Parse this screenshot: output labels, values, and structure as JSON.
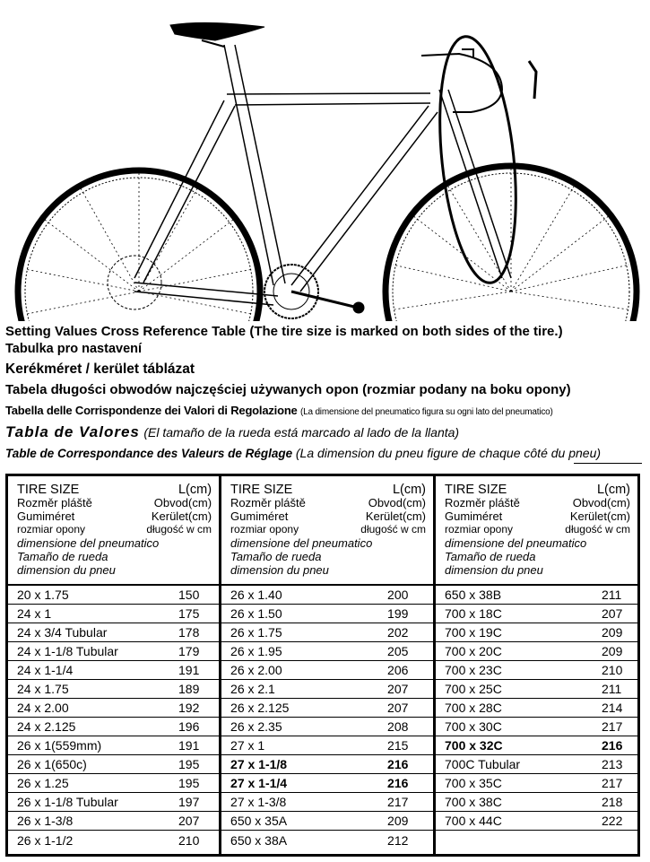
{
  "illustration": {
    "subject": "road-bicycle-side-view",
    "highlight": "front-fork-and-handlebar-ellipse"
  },
  "titles": {
    "english_main": "Setting Values Cross Reference Table",
    "english_note": "(The tire size is marked on both sides of the tire.)",
    "czech": "Tabulka pro nastavení",
    "hungarian": "Kerékméret / kerület táblázat",
    "polish": "Tabela długości obwodów najczęściej używanych opon (rozmiar podany na boku opony)",
    "italian_main": "Tabella delle Corrispondenze dei Valori di Regolazione",
    "italian_note": "(La dimensione del pneumatico figura su ogni lato del pneumatico)",
    "spanish_main": "Tabla de Valores",
    "spanish_note": "(El tamaño de la rueda está marcado al lado de la llanta)",
    "french_main": "Table de Correspondance des Valeurs de Réglage",
    "french_note": "(La dimension du pneu figure de chaque côté du pneu)"
  },
  "header": {
    "size_en": "TIRE SIZE",
    "len_en": "L(cm)",
    "size_cz": "Rozměr pláště",
    "len_cz": "Obvod(cm)",
    "size_hu": "Gumiméret",
    "len_hu": "Kerület(cm)",
    "size_pl": "rozmiar opony",
    "len_pl": "długość w cm",
    "size_it": "dimensione del pneumatico",
    "size_es": "Tamaño de rueda",
    "size_fr": "dimension du pneu"
  },
  "columns": [
    {
      "rows": [
        {
          "size": "20 x 1.75",
          "length": "150",
          "bold": false
        },
        {
          "size": "24 x 1",
          "length": "175",
          "bold": false
        },
        {
          "size": "24 x 3/4 Tubular",
          "length": "178",
          "bold": false
        },
        {
          "size": "24 x 1-1/8 Tubular",
          "length": "179",
          "bold": false
        },
        {
          "size": "24 x 1-1/4",
          "length": "191",
          "bold": false
        },
        {
          "size": "24 x 1.75",
          "length": "189",
          "bold": false
        },
        {
          "size": "24 x 2.00",
          "length": "192",
          "bold": false
        },
        {
          "size": "24 x 2.125",
          "length": "196",
          "bold": false
        },
        {
          "size": "26 x 1(559mm)",
          "length": "191",
          "bold": false
        },
        {
          "size": "26 x 1(650c)",
          "length": "195",
          "bold": false
        },
        {
          "size": "26 x 1.25",
          "length": "195",
          "bold": false
        },
        {
          "size": "26 x 1-1/8 Tubular",
          "length": "197",
          "bold": false
        },
        {
          "size": "26 x 1-3/8",
          "length": "207",
          "bold": false
        },
        {
          "size": "26 x 1-1/2",
          "length": "210",
          "bold": false
        }
      ]
    },
    {
      "rows": [
        {
          "size": "26 x 1.40",
          "length": "200",
          "bold": false
        },
        {
          "size": "26 x 1.50",
          "length": "199",
          "bold": false
        },
        {
          "size": "26 x 1.75",
          "length": "202",
          "bold": false
        },
        {
          "size": "26 x 1.95",
          "length": "205",
          "bold": false
        },
        {
          "size": "26 x 2.00",
          "length": "206",
          "bold": false
        },
        {
          "size": "26 x 2.1",
          "length": "207",
          "bold": false
        },
        {
          "size": "26 x 2.125",
          "length": "207",
          "bold": false
        },
        {
          "size": "26 x 2.35",
          "length": "208",
          "bold": false
        },
        {
          "size": "27 x 1",
          "length": "215",
          "bold": false
        },
        {
          "size": "27 x 1-1/8",
          "length": "216",
          "bold": true
        },
        {
          "size": "27 x 1-1/4",
          "length": "216",
          "bold": true
        },
        {
          "size": "27 x 1-3/8",
          "length": "217",
          "bold": false
        },
        {
          "size": "650 x 35A",
          "length": "209",
          "bold": false
        },
        {
          "size": "650 x 38A",
          "length": "212",
          "bold": false
        }
      ]
    },
    {
      "rows": [
        {
          "size": "650 x 38B",
          "length": "211",
          "bold": false
        },
        {
          "size": "700 x 18C",
          "length": "207",
          "bold": false
        },
        {
          "size": "700 x 19C",
          "length": "209",
          "bold": false
        },
        {
          "size": "700 x 20C",
          "length": "209",
          "bold": false
        },
        {
          "size": "700 x 23C",
          "length": "210",
          "bold": false
        },
        {
          "size": "700 x 25C",
          "length": "211",
          "bold": false
        },
        {
          "size": "700 x 28C",
          "length": "214",
          "bold": false
        },
        {
          "size": "700 x 30C",
          "length": "217",
          "bold": false
        },
        {
          "size": "700 x 32C",
          "length": "216",
          "bold": true
        },
        {
          "size": "700C Tubular",
          "length": "213",
          "bold": false
        },
        {
          "size": "700 x 35C",
          "length": "217",
          "bold": false
        },
        {
          "size": "700 x 38C",
          "length": "218",
          "bold": false
        },
        {
          "size": "700 x 44C",
          "length": "222",
          "bold": false
        },
        {
          "size": "",
          "length": "",
          "bold": false
        }
      ]
    }
  ]
}
